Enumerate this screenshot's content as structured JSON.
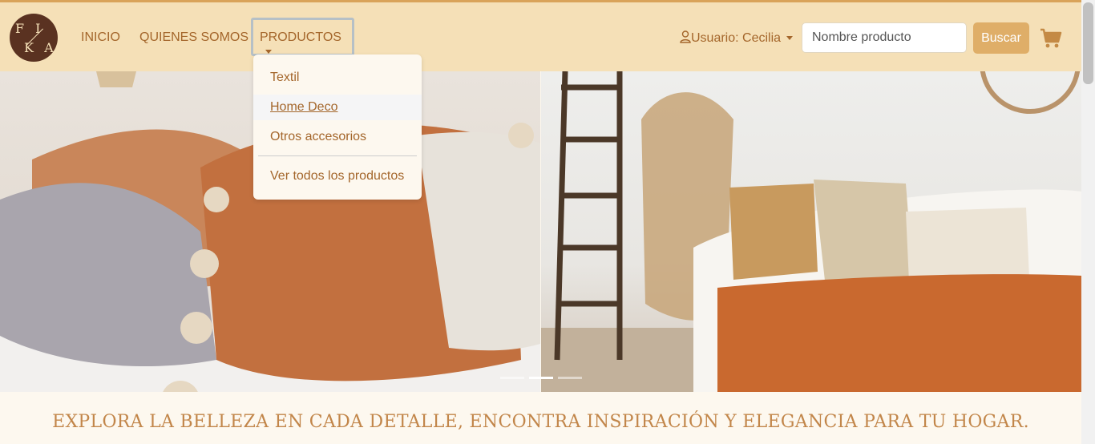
{
  "brand": {
    "logo_text_top": "FI",
    "logo_text_bottom": "KA",
    "logo_bg": "#5a3221"
  },
  "nav": {
    "items": [
      {
        "label": "INICIO"
      },
      {
        "label": "QUIENES SOMOS"
      },
      {
        "label": "PRODUCTOS",
        "expanded": true
      }
    ],
    "dropdown": [
      {
        "label": "Textil"
      },
      {
        "label": "Home Deco",
        "hovered": true
      },
      {
        "label": "Otros accesorios"
      },
      {
        "label": "Ver todos los productos"
      }
    ]
  },
  "user": {
    "label": "Usuario: Cecilia"
  },
  "search": {
    "placeholder": "Nombre producto",
    "button_label": "Buscar"
  },
  "hero": {
    "slides": 3,
    "active_slide": 2
  },
  "tagline": "EXPLORA LA BELLEZA EN CADA DETALLE, ENCONTRA INSPIRACIÓN Y ELEGANCIA PARA TU HOGAR.",
  "colors": {
    "navbar": "#f5e0b7",
    "accent": "#dfae68",
    "link": "#a4662b",
    "tagline": "#c2864a"
  }
}
